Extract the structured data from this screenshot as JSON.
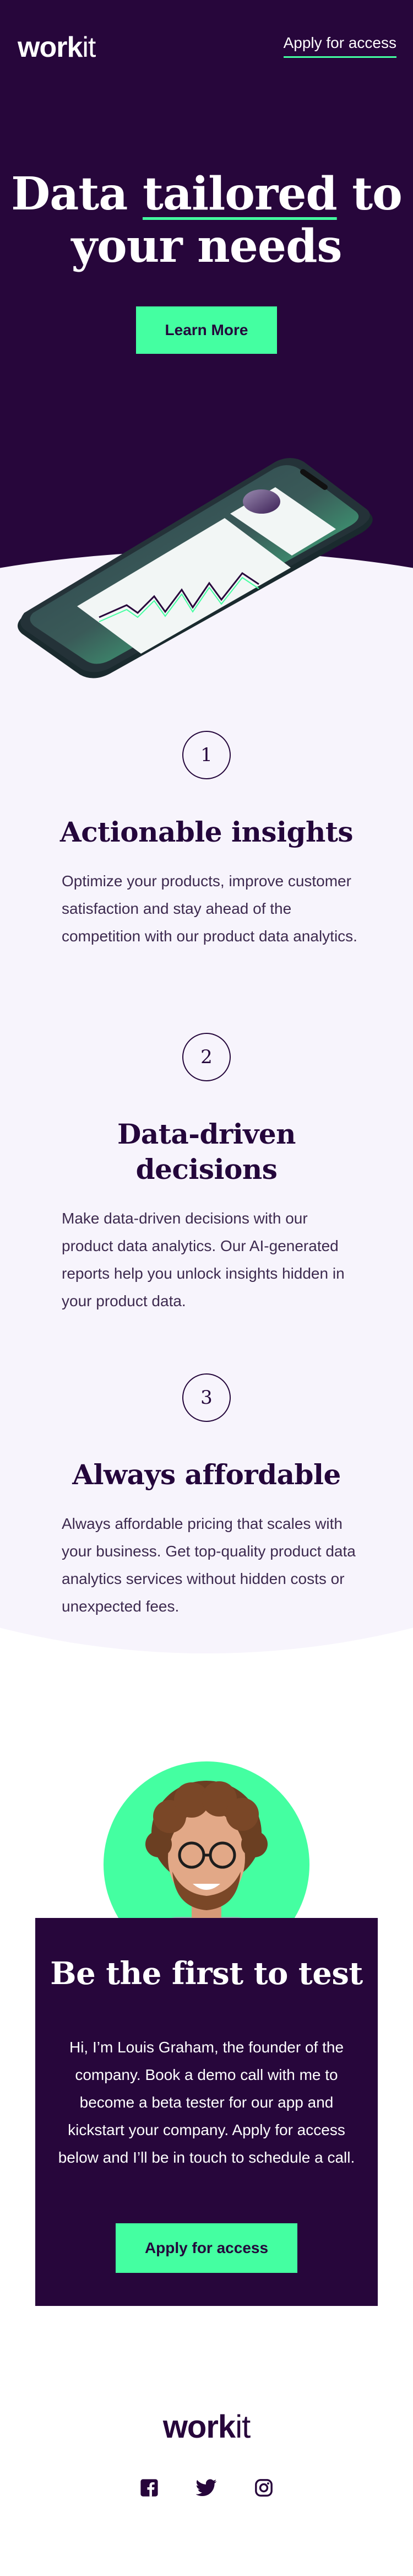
{
  "header": {
    "logo_bold": "work",
    "logo_thin": "it",
    "nav_link": "Apply for access"
  },
  "hero": {
    "title_part1": "Data ",
    "title_underlined": "tailored",
    "title_part2": " to",
    "title_line2": "your needs",
    "cta_label": "Learn More"
  },
  "features": [
    {
      "number": "1",
      "title": "Actionable insights",
      "text": "Optimize your products, improve customer satisfaction and stay ahead of the competition with our product data analytics."
    },
    {
      "number": "2",
      "title_line1": "Data-driven",
      "title_line2": "decisions",
      "text": "Make data-driven decisions with our product data analytics. Our AI-generated reports help you unlock insights hidden in your product data."
    },
    {
      "number": "3",
      "title": "Always affordable",
      "text": "Always affordable pricing that scales with your business. Get top-quality product data analytics services without hidden costs or unexpected fees."
    }
  ],
  "cta": {
    "title": "Be the first to test",
    "text": "Hi, I’m Louis Graham, the founder of the company. Book a demo call with me to become a beta tester for our app and kickstart your company. Apply for access below and I’ll be in touch to schedule a call.",
    "button_label": "Apply for access"
  },
  "footer": {
    "logo_bold": "work",
    "logo_thin": "it",
    "socials": [
      "facebook-icon",
      "twitter-icon",
      "instagram-icon"
    ]
  },
  "colors": {
    "brand_dark": "#27063b",
    "accent_green": "#44ffa1",
    "light_bg": "#f7f4fc"
  }
}
